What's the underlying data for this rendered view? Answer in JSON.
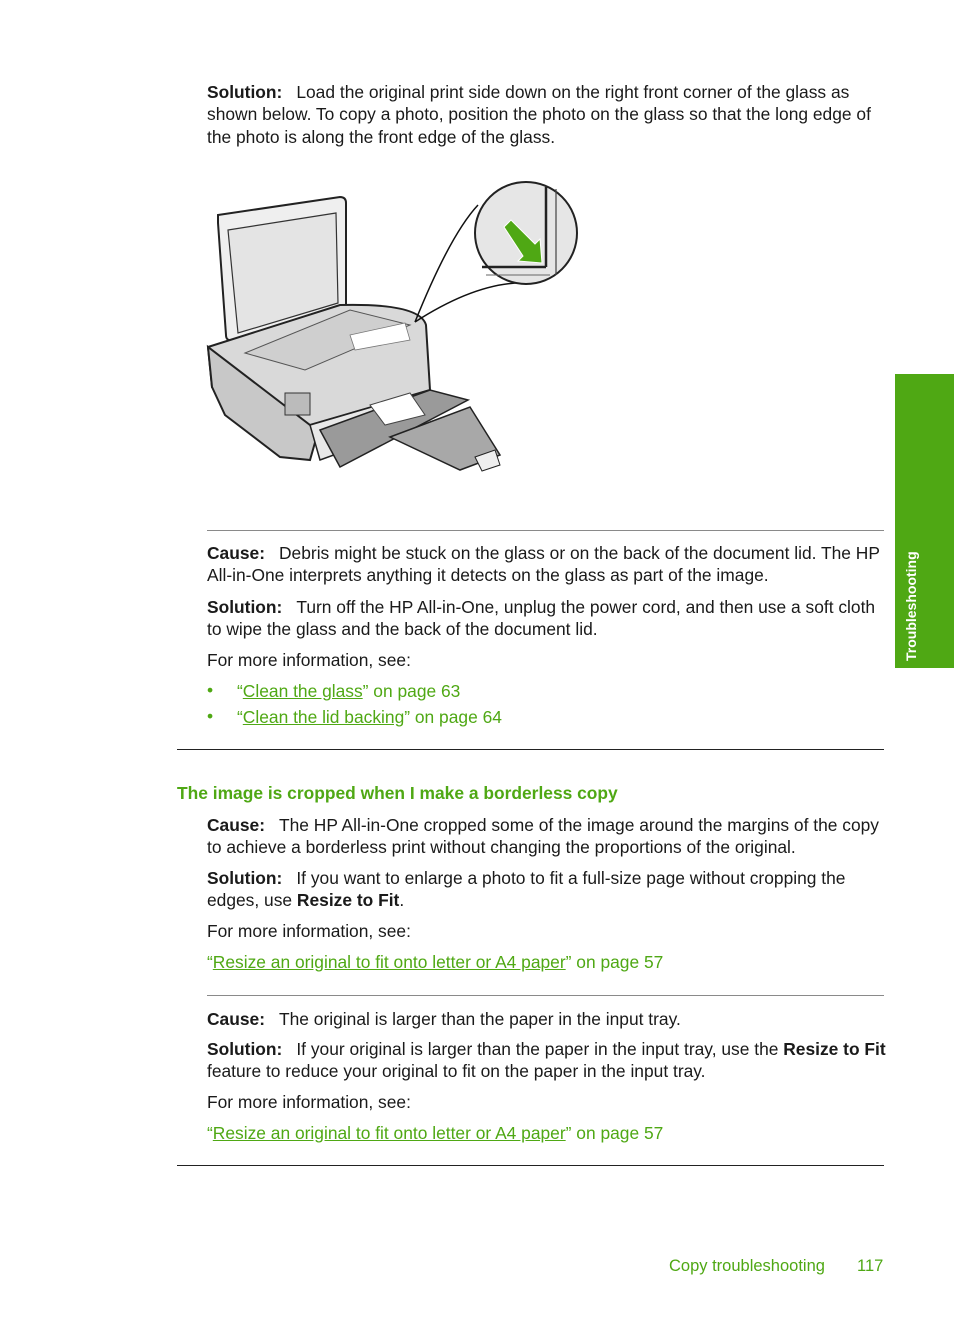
{
  "section1": {
    "solution_label": "Solution:",
    "solution_text": "Load the original print side down on the right front corner of the glass as shown below. To copy a photo, position the photo on the glass so that the long edge of the photo is along the front edge of the glass."
  },
  "illustration": {
    "description": "HP All-in-One printer with lid open; magnified inset showing green arrow pointing to right front corner of glass",
    "arrow_color": "#4fa814"
  },
  "section2": {
    "cause_label": "Cause:",
    "cause_text": "Debris might be stuck on the glass or on the back of the document lid. The HP All-in-One interprets anything it detects on the glass as part of the image.",
    "solution_label": "Solution:",
    "solution_text": "Turn off the HP All-in-One, unplug the power cord, and then use a soft cloth to wipe the glass and the back of the document lid.",
    "more_info": "For more information, see:",
    "links": [
      {
        "open_quote": "“",
        "link_text": "Clean the glass",
        "suffix": "” on page 63"
      },
      {
        "open_quote": "“",
        "link_text": "Clean the lid backing",
        "suffix": "” on page 64"
      }
    ]
  },
  "heading": "The image is cropped when I make a borderless copy",
  "section3": {
    "cause_label": "Cause:",
    "cause_text": "The HP All-in-One cropped some of the image around the margins of the copy to achieve a borderless print without changing the proportions of the original.",
    "solution_label": "Solution:",
    "solution_text_before": "If you want to enlarge a photo to fit a full-size page without cropping the edges, use ",
    "solution_bold": "Resize to Fit",
    "solution_text_after": ".",
    "more_info": "For more information, see:",
    "link": {
      "open_quote": "“",
      "link_text": "Resize an original to fit onto letter or A4 paper",
      "suffix": "” on page 57"
    }
  },
  "section4": {
    "cause_label": "Cause:",
    "cause_text": "The original is larger than the paper in the input tray.",
    "solution_label": "Solution:",
    "solution_text_before": "If your original is larger than the paper in the input tray, use the ",
    "solution_bold": "Resize to Fit",
    "solution_text_after": " feature to reduce your original to fit on the paper in the input tray.",
    "more_info": "For more information, see:",
    "link": {
      "open_quote": "“",
      "link_text": "Resize an original to fit onto letter or A4 paper",
      "suffix": "” on page 57"
    }
  },
  "side_tab": {
    "label": "Troubleshooting",
    "color": "#4fa814"
  },
  "footer": {
    "section": "Copy troubleshooting",
    "page": "117"
  }
}
